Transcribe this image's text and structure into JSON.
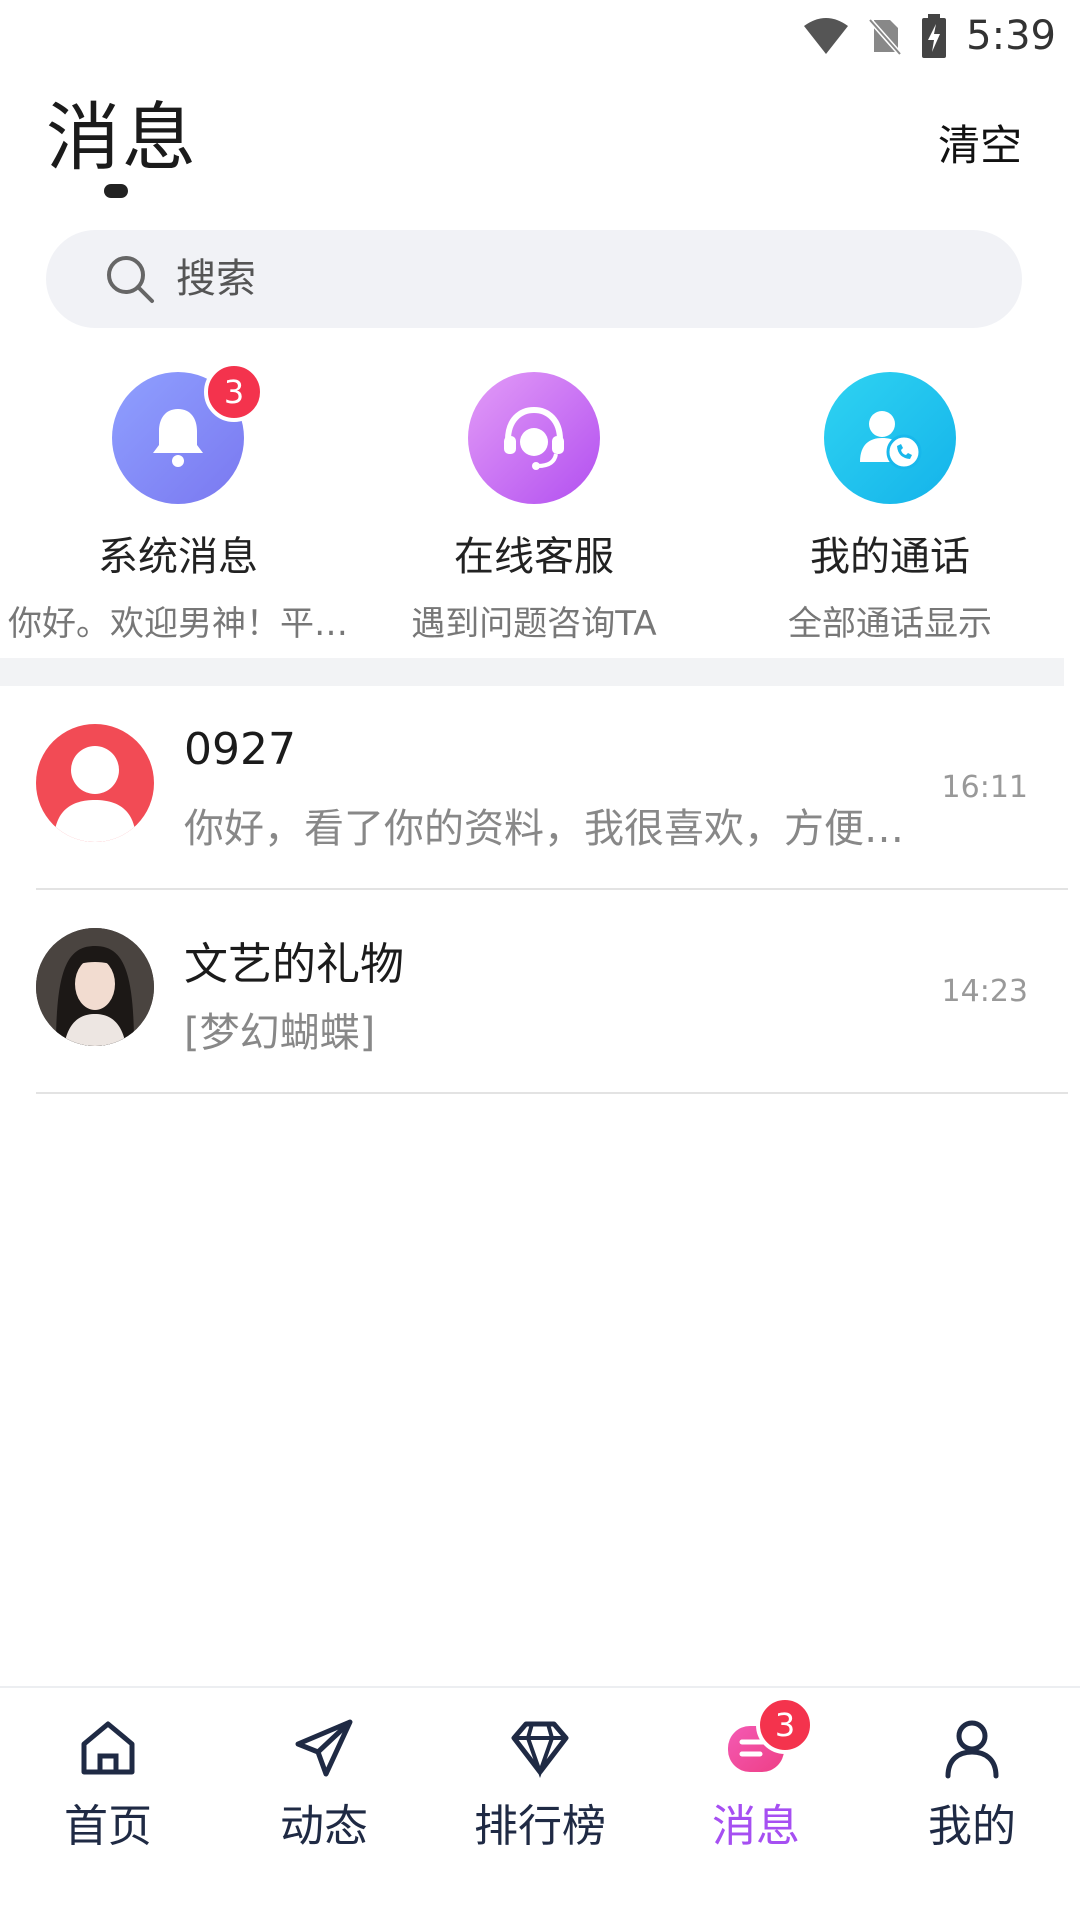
{
  "status_bar": {
    "time": "5:39"
  },
  "header": {
    "title": "消息",
    "clear_label": "清空"
  },
  "search": {
    "placeholder": "搜索"
  },
  "quick_actions": [
    {
      "label": "系统消息",
      "subtitle": "你好。欢迎男神！平…",
      "icon": "bell-icon",
      "badge": "3"
    },
    {
      "label": "在线客服",
      "subtitle": "遇到问题咨询TA",
      "icon": "headset-icon"
    },
    {
      "label": "我的通话",
      "subtitle": "全部通话显示",
      "icon": "call-icon"
    }
  ],
  "chats": [
    {
      "name": "0927",
      "preview": "你好，看了你的资料，我很喜欢，方便…",
      "time": "16:11",
      "avatar": "default-avatar-icon"
    },
    {
      "name": "文艺的礼物",
      "preview": "[梦幻蝴蝶]",
      "time": "14:23",
      "avatar": "user-photo"
    }
  ],
  "tabs": [
    {
      "label": "首页",
      "icon": "home-icon"
    },
    {
      "label": "动态",
      "icon": "paper-plane-icon"
    },
    {
      "label": "排行榜",
      "icon": "diamond-icon"
    },
    {
      "label": "消息",
      "icon": "message-icon",
      "badge": "3",
      "active": true
    },
    {
      "label": "我的",
      "icon": "person-icon"
    }
  ],
  "colors": {
    "accent": "#a64ff2",
    "badge": "#f4334d",
    "default_avatar": "#f24b55"
  }
}
